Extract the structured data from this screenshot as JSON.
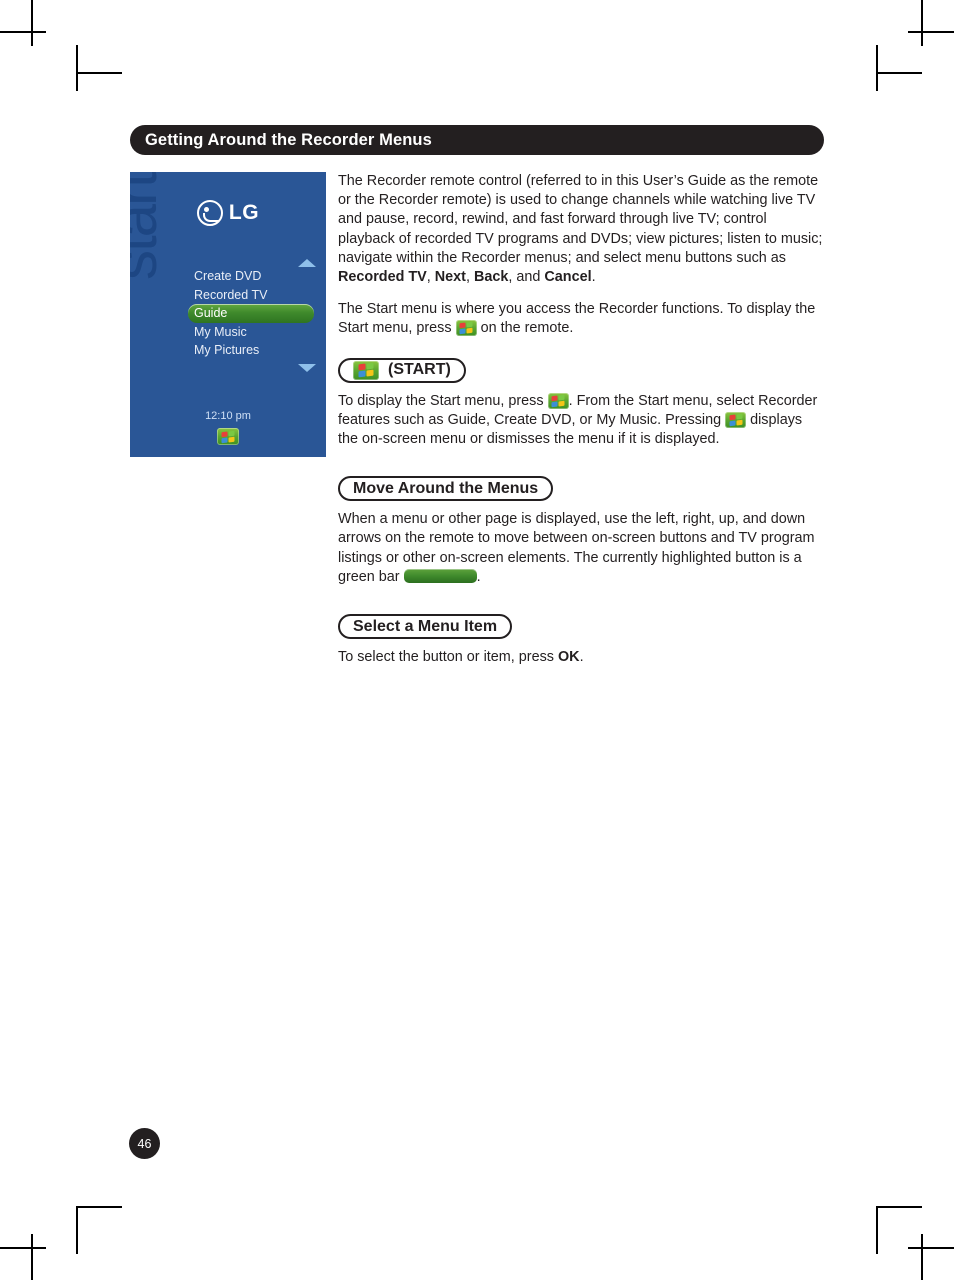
{
  "page": {
    "number": "46"
  },
  "section_header": {
    "title": "Getting Around the Recorder Menus"
  },
  "screen_panel": {
    "brand": "LG",
    "watermark": "start",
    "menu_items": [
      {
        "label": "Create DVD",
        "selected": false
      },
      {
        "label": "Recorded TV",
        "selected": false
      },
      {
        "label": "Guide",
        "selected": true
      },
      {
        "label": "My Music",
        "selected": false
      },
      {
        "label": "My Pictures",
        "selected": false
      }
    ],
    "clock": "12:10 pm",
    "scroll_up_icon": "triangle-up-icon",
    "scroll_down_icon": "triangle-down-icon",
    "tray_icon": "windows-start-icon"
  },
  "body": {
    "paragraph_1_part_1": "The Recorder remote control (referred to in this User’s Guide as the remote or the Recorder remote) is used to change channels while watching live TV and pause, record, rewind, and fast forward through live TV; control playback of recorded TV programs and DVDs; view pictures; listen to music; navigate within the Recorder menus; and select menu buttons such as ",
    "paragraph_1_bold_1": "Recorded TV",
    "paragraph_1_part_2": ", ",
    "paragraph_1_bold_2": "Next",
    "paragraph_1_part_3": ", ",
    "paragraph_1_bold_3": "Back",
    "paragraph_1_part_4": ", and ",
    "paragraph_1_bold_4": "Cancel",
    "paragraph_1_part_5": ".",
    "paragraph_2_part_1": "The Start menu is where you access the Recorder functions. To display the Start menu, press ",
    "paragraph_2_part_2": " on the remote."
  },
  "start_section": {
    "heading_label": "(START)",
    "heading_icon": "windows-start-icon",
    "paragraph_part_1": "To display the Start menu, press ",
    "paragraph_part_2": ". From the Start menu, select Recorder features such as Guide, Create DVD, or My Music. Pressing ",
    "paragraph_part_3": " displays the on-screen menu or dismisses the menu if it is displayed."
  },
  "move_section": {
    "heading": "Move Around the Menus",
    "paragraph_part_1": "When a menu or other page is displayed, use the left, right, up, and down arrows on the remote to move between on-screen buttons and TV program listings or other on-screen elements. The currently highlighted button is a green bar ",
    "paragraph_part_2": "."
  },
  "select_section": {
    "heading": "Select a Menu Item",
    "paragraph_part_1": "To select the button or item, press ",
    "paragraph_bold": "OK",
    "paragraph_part_2": "."
  },
  "colors": {
    "header_bar": "#231f20",
    "screen_blue": "#2a5696",
    "highlight_green": "#3f8a2c",
    "start_button_green": "#5aa630"
  }
}
